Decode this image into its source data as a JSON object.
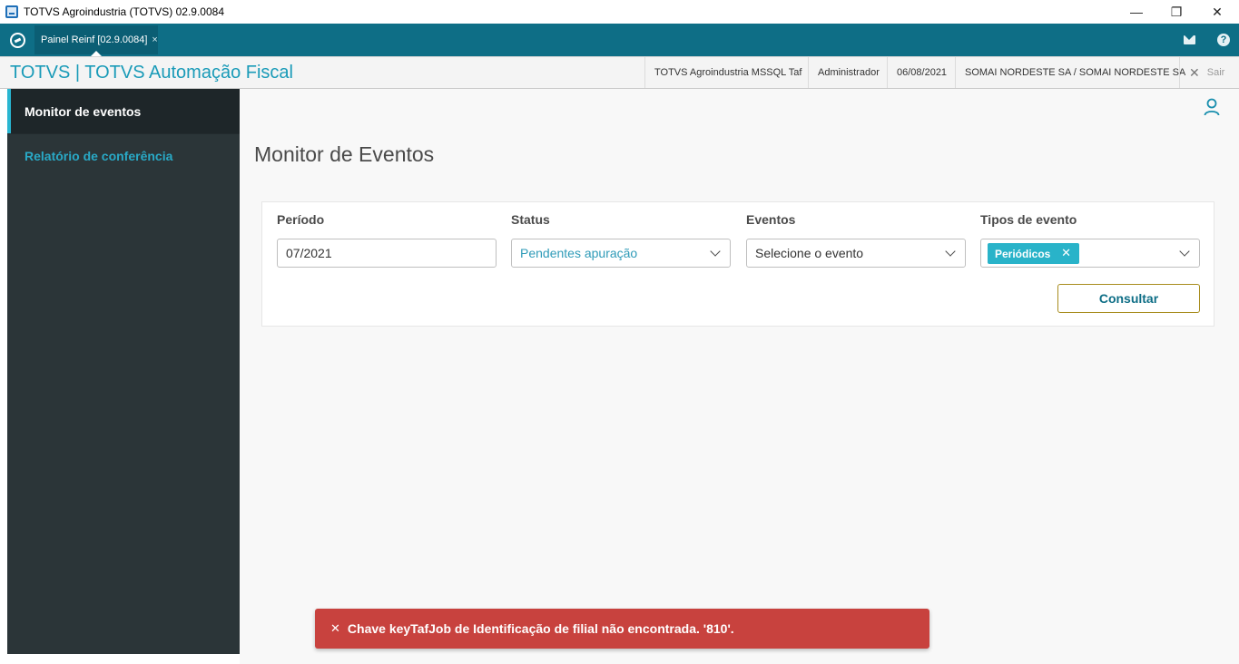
{
  "window": {
    "title": "TOTVS Agroindustria (TOTVS) 02.9.0084",
    "minimize": "—",
    "restore": "❐",
    "close": "✕"
  },
  "tabbar": {
    "tab_label": "Painel Reinf [02.9.0084]",
    "tab_close": "×",
    "help_glyph": "?"
  },
  "header": {
    "app_title": "TOTVS | TOTVS Automação Fiscal",
    "environment": "TOTVS Agroindustria MSSQL Taf",
    "user": "Administrador",
    "date": "06/08/2021",
    "company": "SOMAI NORDESTE SA / SOMAI NORDESTE SA",
    "exit_label": "Sair",
    "exit_glyph": "✕"
  },
  "sidebar": {
    "items": [
      {
        "label": "Monitor de eventos",
        "active": true
      },
      {
        "label": "Relatório de conferência",
        "active": false
      }
    ]
  },
  "main": {
    "page_title": "Monitor de Eventos",
    "filters": {
      "period_label": "Período",
      "period_value": "07/2021",
      "status_label": "Status",
      "status_value": "Pendentes apuração",
      "events_label": "Eventos",
      "events_placeholder": "Selecione o evento",
      "types_label": "Tipos de evento",
      "types_chip": "Periódicos",
      "chip_remove": "✕"
    },
    "consult_button": "Consultar"
  },
  "toast": {
    "close_glyph": "✕",
    "message": "Chave keyTafJob de Identificação de filial não encontrada. '810'."
  },
  "colors": {
    "tabbar": "#0e6e86",
    "accent": "#29b3c9",
    "sidebar": "#2b3538",
    "toast": "#c8423e",
    "button_border": "#a88d1e"
  }
}
